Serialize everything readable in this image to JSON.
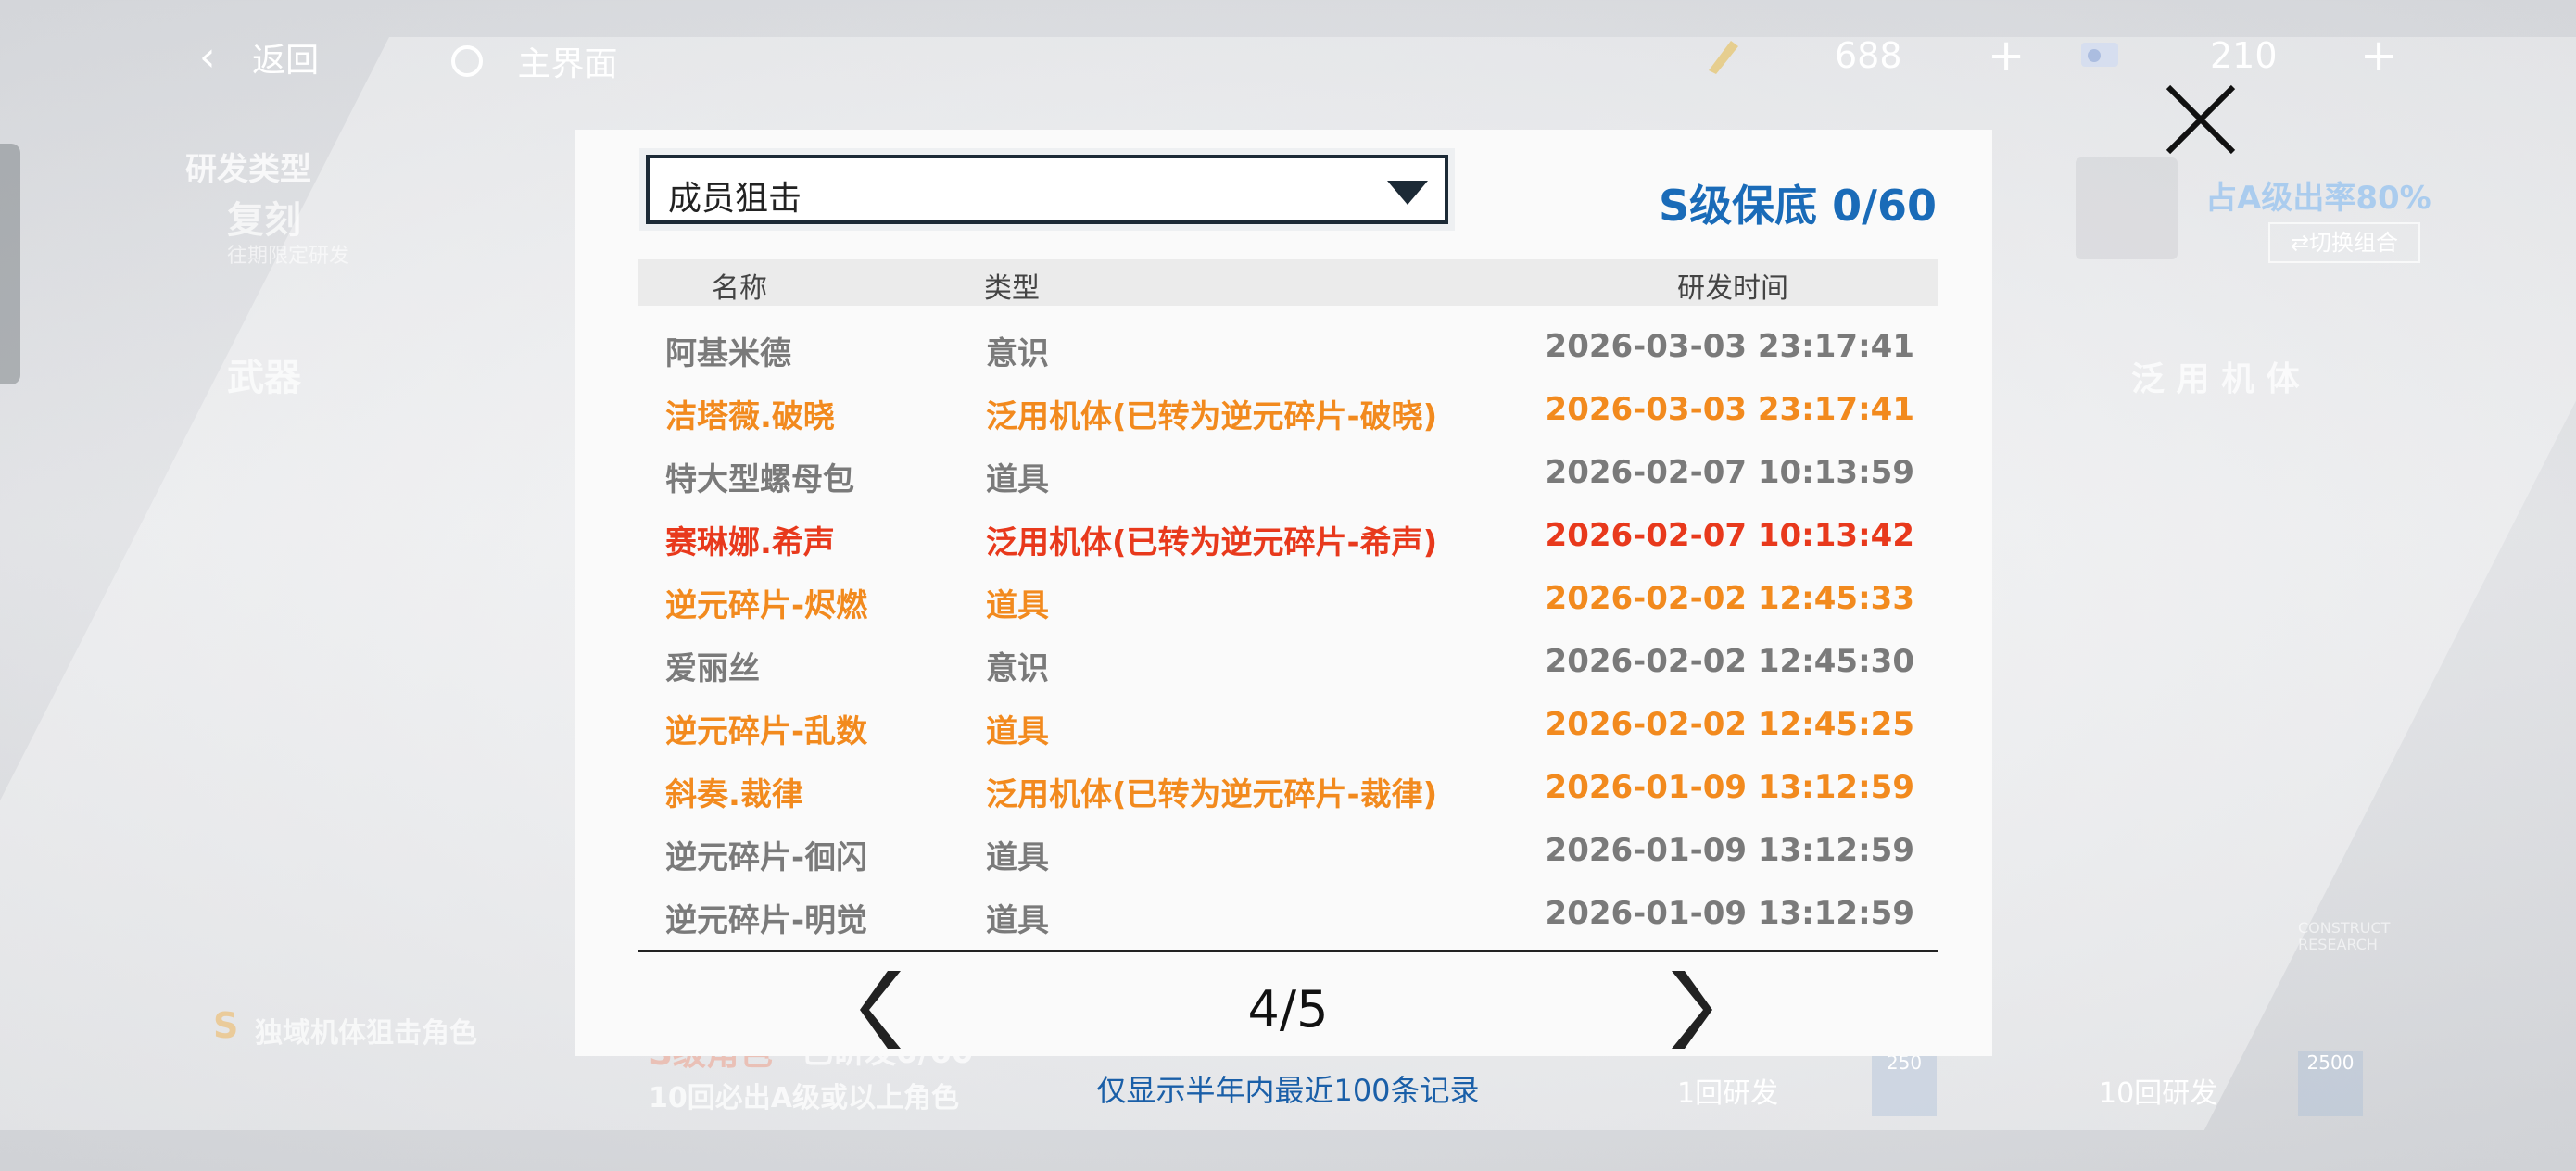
{
  "topbar": {
    "back_label": "返回",
    "home_label": "主界面",
    "currency1_value": "688",
    "currency2_value": "210",
    "plus": "+"
  },
  "background": {
    "dev_type_label": "研发类型",
    "rerun_label": "复刻",
    "rerun_sub": "往期限定研发",
    "weapon_label": "武器",
    "rate_label": "占A级出率80%",
    "switch_label": "切换组合",
    "universal_label": "泛 用 机 体",
    "banner_label": "独域机体狙击角色",
    "s_pity_label": "S级角色",
    "s_pity_count": "已研发0/60",
    "guarantee_label": "10回必出A级或以上角色",
    "single_pull": "1回研发",
    "ten_pull": "10回研发",
    "cost_single": "250",
    "cost_ten": "2500",
    "construct_label": "CONSTRUCT RESEARCH"
  },
  "dialog": {
    "dropdown_value": "成员狙击",
    "pity_text": "S级保底 0/60",
    "columns": [
      "名称",
      "类型",
      "研发时间"
    ],
    "rows": [
      {
        "name": "阿基米德",
        "type": "意识",
        "time": "2026-03-03 23:17:41",
        "color": "#7a7a7a"
      },
      {
        "name": "洁塔薇.破晓",
        "type": "泛用机体(已转为逆元碎片-破晓)",
        "time": "2026-03-03 23:17:41",
        "color": "#f28a1e"
      },
      {
        "name": "特大型螺母包",
        "type": "道具",
        "time": "2026-02-07 10:13:59",
        "color": "#7a7a7a"
      },
      {
        "name": "赛琳娜.希声",
        "type": "泛用机体(已转为逆元碎片-希声)",
        "time": "2026-02-07 10:13:42",
        "color": "#e8391c"
      },
      {
        "name": "逆元碎片-烬燃",
        "type": "道具",
        "time": "2026-02-02 12:45:33",
        "color": "#f28a1e"
      },
      {
        "name": "爱丽丝",
        "type": "意识",
        "time": "2026-02-02 12:45:30",
        "color": "#7a7a7a"
      },
      {
        "name": "逆元碎片-乱数",
        "type": "道具",
        "time": "2026-02-02 12:45:25",
        "color": "#f28a1e"
      },
      {
        "name": "斜奏.裁律",
        "type": "泛用机体(已转为逆元碎片-裁律)",
        "time": "2026-01-09 13:12:59",
        "color": "#f28a1e"
      },
      {
        "name": "逆元碎片-徊闪",
        "type": "道具",
        "time": "2026-01-09 13:12:59",
        "color": "#7a7a7a"
      },
      {
        "name": "逆元碎片-明觉",
        "type": "道具",
        "time": "2026-01-09 13:12:59",
        "color": "#7a7a7a"
      }
    ],
    "page_indicator": "4/5",
    "footnote": "仅显示半年内最近100条记录"
  },
  "colors": {
    "accent_blue": "#1a6bb8",
    "gray_text": "#7a7a7a",
    "orange_text": "#f28a1e",
    "red_text": "#e8391c"
  }
}
